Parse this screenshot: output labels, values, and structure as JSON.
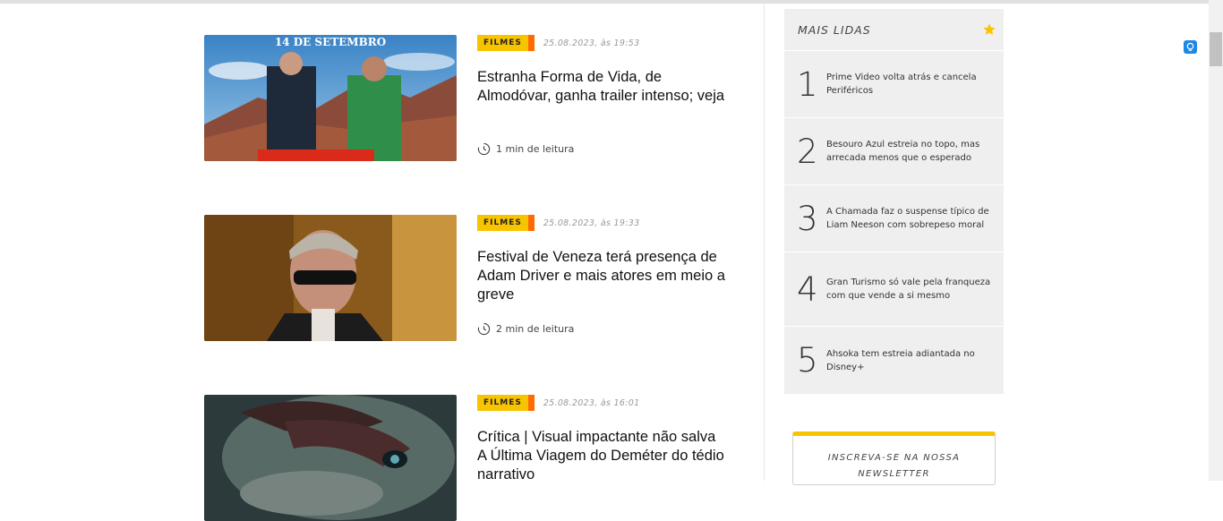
{
  "articles": [
    {
      "tag": "FILMES",
      "date": "25.08.2023, às 19:53",
      "title": "Estranha Forma de Vida, de Almodóvar, ganha trailer intenso; veja",
      "read_time": "1 min de leitura",
      "image_text": "14 DE SETEMBRO"
    },
    {
      "tag": "FILMES",
      "date": "25.08.2023, às 19:33",
      "title": "Festival de Veneza terá presença de Adam Driver e mais atores em meio a greve",
      "read_time": "2 min de leitura"
    },
    {
      "tag": "FILMES",
      "date": "25.08.2023, às 16:01",
      "title": "Crítica | Visual impactante não salva A Última Viagem do Deméter do tédio narrativo",
      "read_time": ""
    }
  ],
  "sidebar": {
    "title": "MAIS LIDAS",
    "icon": "star-icon",
    "accent": "#f8c400",
    "items": [
      {
        "num": "1",
        "text": "Prime Video volta atrás e cancela Periféricos"
      },
      {
        "num": "2",
        "text": "Besouro Azul estreia no topo, mas arrecada menos que o esperado"
      },
      {
        "num": "3",
        "text": "A Chamada faz o suspense típico de Liam Neeson com sobrepeso moral"
      },
      {
        "num": "4",
        "text": "Gran Turismo só vale pela franqueza com que vende a si mesmo"
      },
      {
        "num": "5",
        "text": "Ahsoka tem estreia adiantada no Disney+"
      }
    ]
  },
  "newsletter": {
    "line1": "INSCREVA-SE NA NOSSA",
    "line2": "NEWSLETTER"
  },
  "colors": {
    "tag_bg": "#f8c400",
    "tag_edge": "#ff6a00"
  }
}
